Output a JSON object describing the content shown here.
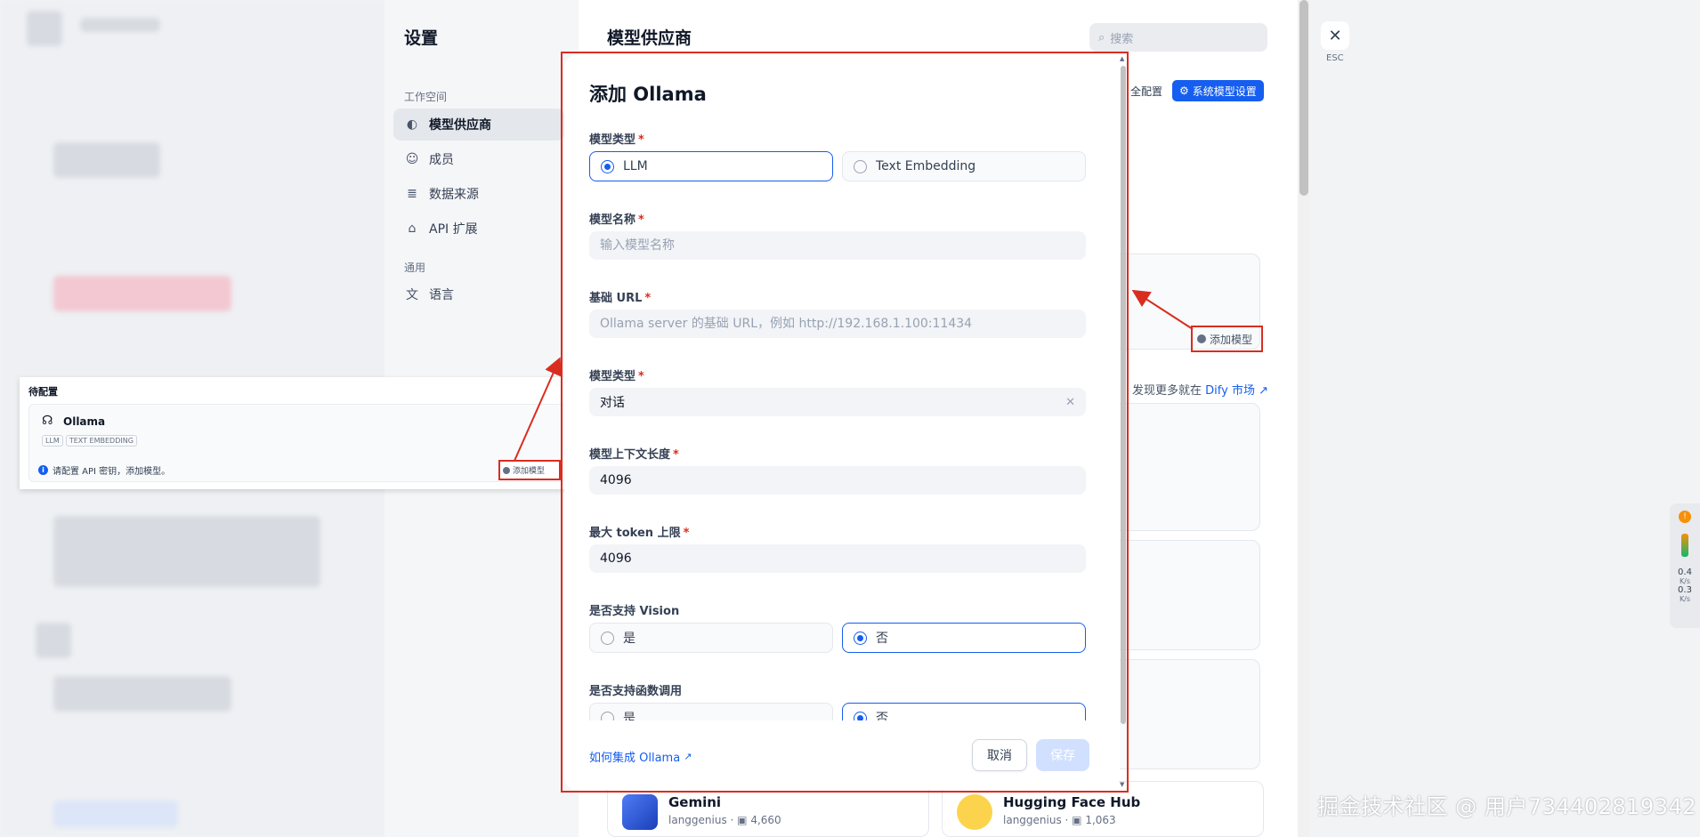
{
  "settings": {
    "title": "设置",
    "section_workspace": "工作空间",
    "section_general": "通用",
    "nav": [
      {
        "label": "模型供应商",
        "icon": "brain-icon"
      },
      {
        "label": "成员",
        "icon": "members-icon"
      },
      {
        "label": "数据来源",
        "icon": "database-icon"
      },
      {
        "label": "API 扩展",
        "icon": "puzzle-icon"
      },
      {
        "label": "语言",
        "icon": "translate-icon"
      }
    ]
  },
  "main": {
    "title": "模型供应商",
    "search_placeholder": "搜索",
    "config_link": "全配置",
    "system_model_button": "系统模型设置",
    "add_model_label": "添加模型",
    "market_prefix": "发现更多就在",
    "market_link": "Dify 市场 ↗",
    "bottom_cards": [
      {
        "name": "Gemini",
        "author": "langgenius",
        "count": "4,660"
      },
      {
        "name": "Hugging Face Hub",
        "author": "langgenius",
        "count": "1,063"
      }
    ]
  },
  "close": {
    "esc_label": "ESC"
  },
  "side_widget": {
    "badge": "!",
    "v1": "0.4",
    "u1": "K/s",
    "v2": "0.3",
    "u2": "K/s"
  },
  "callout": {
    "title": "待配置",
    "provider": "Ollama",
    "tags": [
      "LLM",
      "TEXT EMBEDDING"
    ],
    "note": "请配置 API 密钥，添加模型。",
    "add_model_label": "添加模型"
  },
  "modal": {
    "title": "添加 Ollama",
    "model_type_label": "模型类型",
    "model_type_options": [
      "LLM",
      "Text Embedding"
    ],
    "model_name_label": "模型名称",
    "model_name_placeholder": "输入模型名称",
    "base_url_label": "基础 URL",
    "base_url_placeholder": "Ollama server 的基础 URL，例如 http://192.168.1.100:11434",
    "model_type2_label": "模型类型",
    "model_type2_value": "对话",
    "context_label": "模型上下文长度",
    "context_value": "4096",
    "max_token_label": "最大 token 上限",
    "max_token_value": "4096",
    "vision_label": "是否支持 Vision",
    "vision_options": [
      "是",
      "否"
    ],
    "function_label": "是否支持函数调用",
    "function_options": [
      "是",
      "否"
    ],
    "help_link": "如何集成 Ollama",
    "cancel": "取消",
    "save": "保存",
    "required_mark": "*"
  },
  "watermark": "掘金技术社区 @ 用户734402819342",
  "colors": {
    "accent": "#155eef",
    "annotation_red": "#d92d20"
  }
}
